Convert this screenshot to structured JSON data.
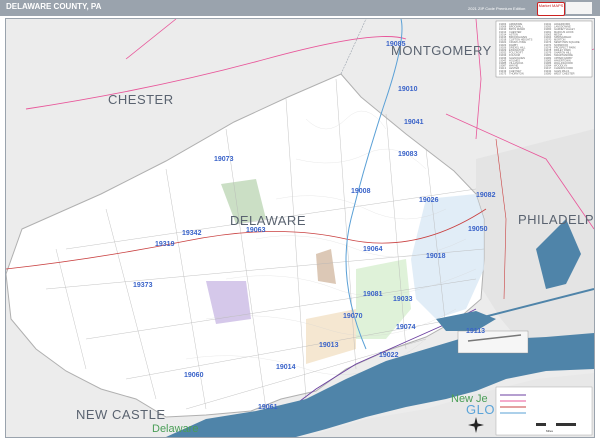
{
  "title": "DELAWARE COUNTY, PA",
  "edition": "2021 ZIP Code Premium Edition",
  "brand": "Market MAPS",
  "counties": {
    "delaware": "DELAWARE",
    "chester": "CHESTER",
    "montgomery": "MONTGOMERY",
    "philadelphia": "PHILADELPHIA",
    "new_castle": "NEW CASTLE",
    "gloucester": "GLOU",
    "new_jersey": "New Je"
  },
  "state_label": "Delaware",
  "zip_codes": [
    "19085",
    "19010",
    "19041",
    "19083",
    "19073",
    "19008",
    "19082",
    "19026",
    "19342",
    "19063",
    "19050",
    "19064",
    "19018",
    "19319",
    "19373",
    "19033",
    "19081",
    "19070",
    "19074",
    "19113",
    "19014",
    "19013",
    "19022",
    "19060",
    "19061",
    "19015"
  ],
  "legend": {
    "rows": [
      [
        "19003",
        "ARDMORE",
        "19041",
        "HAVERFORD"
      ],
      [
        "19008",
        "BROOMALL",
        "19050",
        "LANSDOWNE"
      ],
      [
        "19010",
        "BRYN MAWR",
        "19060",
        "GARNET VALLEY"
      ],
      [
        "19013",
        "CHESTER",
        "19061",
        "MARCUS HOOK"
      ],
      [
        "19014",
        "ASTON",
        "19063",
        "MEDIA"
      ],
      [
        "19015",
        "BROOKHAVEN",
        "19064",
        "SPRINGFIELD"
      ],
      [
        "19018",
        "CLIFTON HEIGHTS",
        "19070",
        "MORTON"
      ],
      [
        "19022",
        "CRUM LYNNE",
        "19073",
        "NEWTOWN SQUARE"
      ],
      [
        "19023",
        "DARBY",
        "19074",
        "NORWOOD"
      ],
      [
        "19026",
        "DREXEL HILL",
        "19076",
        "PROSPECT PARK"
      ],
      [
        "19029",
        "ESSINGTON",
        "19078",
        "RIDLEY PARK"
      ],
      [
        "19032",
        "FOLCROFT",
        "19079",
        "SHARON HILL"
      ],
      [
        "19033",
        "FOLSOM",
        "19081",
        "SWARTHMORE"
      ],
      [
        "19036",
        "GLENOLDEN",
        "19082",
        "UPPER DARBY"
      ],
      [
        "19043",
        "HOLMES",
        "19083",
        "HAVERTOWN"
      ],
      [
        "19085",
        "VILLANOVA",
        "19086",
        "WALLINGFORD"
      ],
      [
        "19087",
        "WAYNE",
        "19094",
        "WOODLYN"
      ],
      [
        "19113",
        "LESTER",
        "19317",
        "CHADDS FORD"
      ],
      [
        "19319",
        "CHEYNEY",
        "19342",
        "GLEN MILLS"
      ],
      [
        "19373",
        "THORNTON",
        "19380",
        "WEST CHESTER"
      ]
    ]
  },
  "scale_label": "Miles",
  "colors": {
    "land": "#ececec",
    "county": "#ffffff",
    "water": "#4f84a9",
    "zip_label": "#3a63c9",
    "highway_pink": "#e8579a",
    "highway_purple": "#6b3fa0",
    "road_red": "#c94040"
  }
}
